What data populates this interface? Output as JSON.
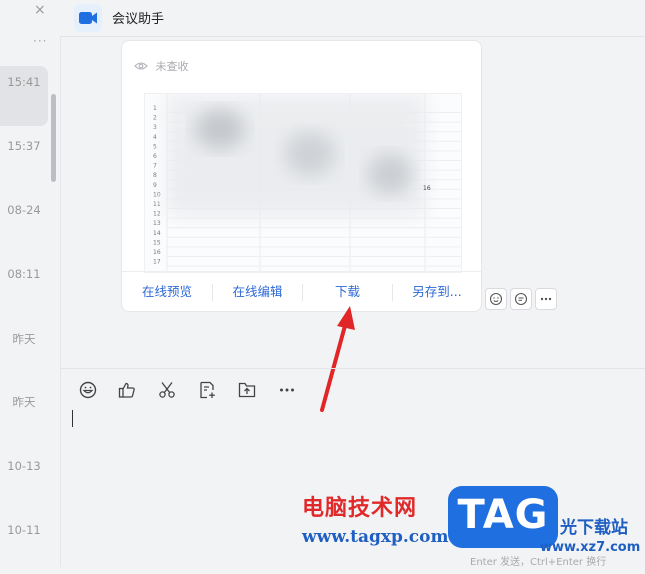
{
  "left_list": {
    "close_glyph": "×",
    "more_glyph": "···",
    "times": [
      "15:41",
      "15:37",
      "08-24",
      "08:11",
      "昨天",
      "昨天",
      "10-13",
      "10-11"
    ]
  },
  "header": {
    "title": "会议助手",
    "icon": "video-camera-icon",
    "icon_color": "#1f6fe0"
  },
  "message": {
    "read_status": "未查收",
    "actions": [
      "在线预览",
      "在线编辑",
      "下载",
      "另存到..."
    ],
    "row_numbers": [
      "1",
      "2",
      "3",
      "4",
      "5",
      "6",
      "7",
      "8",
      "9",
      "10",
      "11",
      "12",
      "13",
      "14",
      "15",
      "16",
      "17"
    ],
    "cell_text": "16"
  },
  "input": {
    "send_hint": "Enter 发送，Ctrl+Enter 换行",
    "toolbar": [
      "emoji-icon",
      "thumbs-up-icon",
      "scissors-icon",
      "doc-template-icon",
      "upload-file-icon",
      "more-icon"
    ]
  },
  "watermark": {
    "chinese": "电脑技术网",
    "url": "www.tagxp.com",
    "tag": "TAG",
    "site": "光下载站",
    "site2": "www.xz7.com"
  },
  "colors": {
    "link": "#2c68d6",
    "arrow": "#e02626",
    "watermark_red": "#e02a2a",
    "watermark_blue": "#1f5fc2"
  }
}
